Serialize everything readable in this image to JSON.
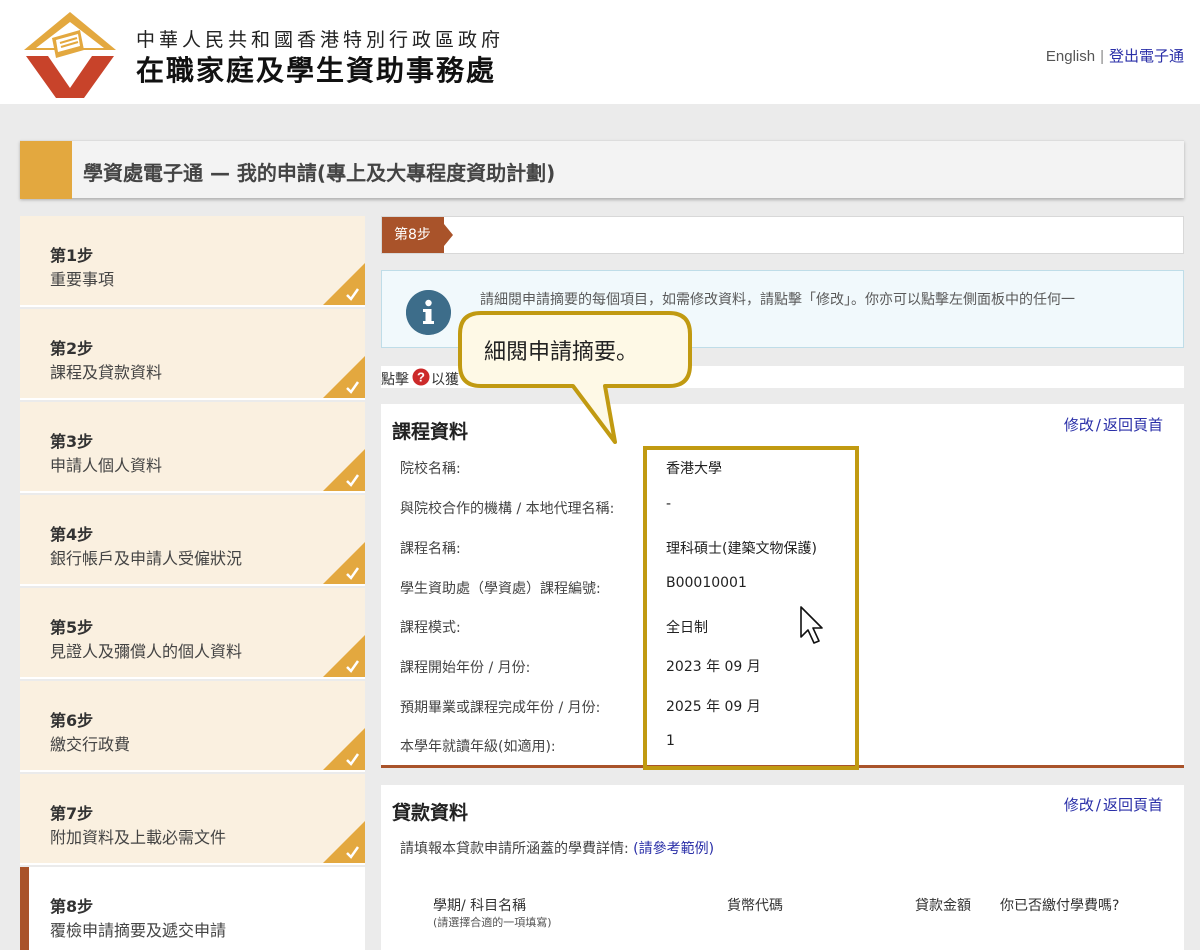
{
  "header": {
    "org_line1": "中華人民共和國香港特別行政區政府",
    "org_line2": "在職家庭及學生資助事務處",
    "language_link": "English",
    "separator": "|",
    "logout_link": "登出電子通"
  },
  "page": {
    "title": "學資處電子通 — 我的申請(專上及大專程度資助計劃)"
  },
  "sidebar": {
    "steps": [
      {
        "title": "第1步",
        "desc": "重要事項",
        "completed": true
      },
      {
        "title": "第2步",
        "desc": "課程及貸款資料",
        "completed": true
      },
      {
        "title": "第3步",
        "desc": "申請人個人資料",
        "completed": true
      },
      {
        "title": "第4步",
        "desc": "銀行帳戶及申請人受僱狀況",
        "completed": true
      },
      {
        "title": "第5步",
        "desc": "見證人及彌償人的個人資料",
        "completed": true
      },
      {
        "title": "第6步",
        "desc": "繳交行政費",
        "completed": true
      },
      {
        "title": "第7步",
        "desc": "附加資料及上載必需文件",
        "completed": true
      },
      {
        "title": "第8步",
        "desc": "覆檢申請摘要及遞交申請",
        "completed": false,
        "current": true
      }
    ]
  },
  "main": {
    "step_tag": "第8步",
    "info_text": "請細閱申請摘要的每個項目，如需修改資料，請點擊「修改」。你亦可以點擊左側面板中的任何一",
    "help_text_prefix": "點擊",
    "help_text_suffix": "以獲",
    "callout_text": "細閱申請摘要。",
    "course_section": {
      "title": "課程資料",
      "edit_label": "修改",
      "separator": "/",
      "back_label": "返回頁首",
      "rows": [
        {
          "label": "院校名稱:",
          "value": "香港大學"
        },
        {
          "label": "與院校合作的機構 / 本地代理名稱:",
          "value": "-"
        },
        {
          "label": "課程名稱:",
          "value": "理科碩士(建築文物保護)"
        },
        {
          "label": "學生資助處（學資處）課程編號:",
          "value": "B00010001"
        },
        {
          "label": "課程模式:",
          "value": "全日制"
        },
        {
          "label": "課程開始年份 / 月份:",
          "value": "2023 年 09 月"
        },
        {
          "label": "預期畢業或課程完成年份 / 月份:",
          "value": "2025 年 09 月"
        },
        {
          "label": "本學年就讀年級(如適用):",
          "value": "1"
        }
      ]
    },
    "loan_section": {
      "title": "貸款資料",
      "edit_label": "修改",
      "separator": "/",
      "back_label": "返回頁首",
      "description": "請填報本貸款申請所涵蓋的學費詳情:",
      "reference_link": "(請參考範例)",
      "columns": [
        "學期/ 科目名稱",
        "貨幣代碼",
        "貸款金額",
        "你已否繳付學費嗎?"
      ],
      "column_note": "(請選擇合適的一項填寫)"
    }
  },
  "colors": {
    "accent_orange": "#e3a83f",
    "step_brown": "#a9532a",
    "highlight_gold": "#c19a11",
    "link_blue": "#2a2fa8",
    "info_icon": "#3d6d8a"
  }
}
